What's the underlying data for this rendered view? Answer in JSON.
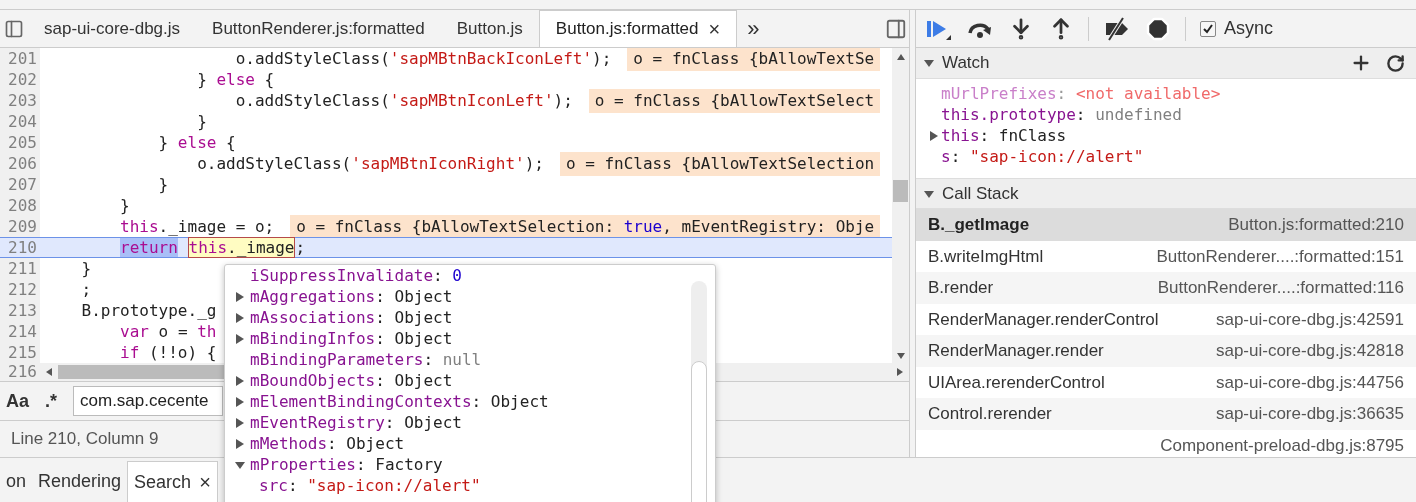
{
  "editor": {
    "tabs": [
      {
        "label": "sap-ui-core-dbg.js",
        "selected": false
      },
      {
        "label": "ButtonRenderer.js:formatted",
        "selected": false
      },
      {
        "label": "Button.js",
        "selected": false
      },
      {
        "label": "Button.js:formatted",
        "selected": true,
        "close": "×"
      }
    ],
    "more_tabs": "»",
    "lines": [
      {
        "number": "201",
        "current": false,
        "tokens": [
          {
            "text": "                    o.addStyleClass(",
            "kind": "plain"
          },
          {
            "text": "'sapMBtnBackIconLeft'",
            "kind": "string"
          },
          {
            "text": ");",
            "kind": "plain"
          }
        ],
        "annotation": [
          {
            "text": "o = fnClass {bAllowTextSe",
            "kind": "plain"
          }
        ]
      },
      {
        "number": "202",
        "current": false,
        "tokens": [
          {
            "text": "                } ",
            "kind": "plain"
          },
          {
            "text": "else",
            "kind": "keyword"
          },
          {
            "text": " {",
            "kind": "plain"
          }
        ]
      },
      {
        "number": "203",
        "current": false,
        "tokens": [
          {
            "text": "                    o.addStyleClass(",
            "kind": "plain"
          },
          {
            "text": "'sapMBtnIconLeft'",
            "kind": "string"
          },
          {
            "text": ");",
            "kind": "plain"
          }
        ],
        "annotation": [
          {
            "text": "o = fnClass {bAllowTextSelect",
            "kind": "plain"
          }
        ]
      },
      {
        "number": "204",
        "current": false,
        "tokens": [
          {
            "text": "                }",
            "kind": "plain"
          }
        ]
      },
      {
        "number": "205",
        "current": false,
        "tokens": [
          {
            "text": "            } ",
            "kind": "plain"
          },
          {
            "text": "else",
            "kind": "keyword"
          },
          {
            "text": " {",
            "kind": "plain"
          }
        ]
      },
      {
        "number": "206",
        "current": false,
        "tokens": [
          {
            "text": "                o.addStyleClass(",
            "kind": "plain"
          },
          {
            "text": "'sapMBtnIconRight'",
            "kind": "string"
          },
          {
            "text": ");",
            "kind": "plain"
          }
        ],
        "annotation": [
          {
            "text": "o = fnClass {bAllowTextSelection",
            "kind": "plain"
          }
        ]
      },
      {
        "number": "207",
        "current": false,
        "tokens": [
          {
            "text": "            }",
            "kind": "plain"
          }
        ]
      },
      {
        "number": "208",
        "current": false,
        "tokens": [
          {
            "text": "        }",
            "kind": "plain"
          }
        ]
      },
      {
        "number": "209",
        "current": false,
        "tokens": [
          {
            "text": "        this",
            "kind": "keyword"
          },
          {
            "text": "._image = o;",
            "kind": "plain"
          }
        ],
        "annotation": [
          {
            "text": "o = fnClass {bAllowTextSelection: ",
            "kind": "plain"
          },
          {
            "text": "true",
            "kind": "literal"
          },
          {
            "text": ", mEventRegistry: Obje",
            "kind": "plain"
          }
        ]
      },
      {
        "number": "210",
        "current": true,
        "tokens": [
          {
            "text": "        return",
            "kind": "keyword-selected"
          },
          {
            "text": " this",
            "kind": "keyword-evaluated"
          },
          {
            "text": "._image",
            "kind": "evaluated"
          },
          {
            "text": ";",
            "kind": "plain"
          }
        ]
      },
      {
        "number": "211",
        "current": false,
        "tokens": [
          {
            "text": "    }",
            "kind": "plain"
          }
        ]
      },
      {
        "number": "212",
        "current": false,
        "tokens": [
          {
            "text": "    ;",
            "kind": "plain"
          }
        ]
      },
      {
        "number": "213",
        "current": false,
        "tokens": [
          {
            "text": "    B.prototype._g",
            "kind": "plain"
          }
        ]
      },
      {
        "number": "214",
        "current": false,
        "tokens": [
          {
            "text": "        var",
            "kind": "keyword"
          },
          {
            "text": " o = ",
            "kind": "plain"
          },
          {
            "text": "th",
            "kind": "keyword"
          }
        ]
      },
      {
        "number": "215",
        "current": false,
        "tokens": [
          {
            "text": "        if",
            "kind": "keyword"
          },
          {
            "text": " (!!o) {",
            "kind": "plain"
          }
        ]
      }
    ],
    "last_line_number": "216",
    "search": {
      "case_toggle": "Aa",
      "regex_toggle": ".*",
      "value": "com.sap.cecente"
    },
    "status": "Line 210, Column 9",
    "popover": [
      {
        "key": "iSuppressInvalidate",
        "separator": ":",
        "value": "0",
        "kind": "number"
      },
      {
        "key": "mAggregations",
        "separator": ":",
        "value": "Object",
        "kind": "object",
        "expanded": false
      },
      {
        "key": "mAssociations",
        "separator": ":",
        "value": "Object",
        "kind": "object",
        "expanded": false
      },
      {
        "key": "mBindingInfos",
        "separator": ":",
        "value": "Object",
        "kind": "object",
        "expanded": false
      },
      {
        "key": "mBindingParameters",
        "separator": ":",
        "value": "null",
        "kind": "null"
      },
      {
        "key": "mBoundObjects",
        "separator": ":",
        "value": "Object",
        "kind": "object",
        "expanded": false
      },
      {
        "key": "mElementBindingContexts",
        "separator": ":",
        "value": "Object",
        "kind": "object",
        "expanded": false
      },
      {
        "key": "mEventRegistry",
        "separator": ":",
        "value": "Object",
        "kind": "object",
        "expanded": false
      },
      {
        "key": "mMethods",
        "separator": ":",
        "value": "Object",
        "kind": "object",
        "expanded": false
      },
      {
        "key": "mProperties",
        "separator": ":",
        "value": "Factory",
        "kind": "object",
        "expanded": true,
        "children": [
          {
            "key": "src",
            "separator": ":",
            "value": "\"sap-icon://alert\"",
            "kind": "string"
          }
        ]
      }
    ]
  },
  "debugger": {
    "async": {
      "label": "Async",
      "checked": true
    },
    "watch": {
      "title": "Watch",
      "expanded": true,
      "items": [
        {
          "name": "mUrlPrefixes",
          "separator": ":",
          "value": "<not available>",
          "kind": "unavailable"
        },
        {
          "name": "this.prototype",
          "separator": ":",
          "value": "undefined",
          "kind": "undefined"
        },
        {
          "name": "this",
          "separator": ":",
          "value": "fnClass",
          "kind": "object",
          "expanded": false
        },
        {
          "name": "s",
          "separator": ":",
          "value": "\"sap-icon://alert\"",
          "kind": "string"
        }
      ]
    },
    "call_stack": {
      "title": "Call Stack",
      "expanded": true,
      "frames": [
        {
          "name": "B._getImage",
          "location": "Button.js:formatted:210",
          "selected": true
        },
        {
          "name": "B.writeImgHtml",
          "location": "ButtonRenderer....:formatted:151",
          "selected": false
        },
        {
          "name": "B.render",
          "location": "ButtonRenderer....:formatted:116",
          "selected": false
        },
        {
          "name": "RenderManager.renderControl",
          "location": "sap-ui-core-dbg.js:42591",
          "selected": false
        },
        {
          "name": "RenderManager.render",
          "location": "sap-ui-core-dbg.js:42818",
          "selected": false
        },
        {
          "name": "UIArea.rerenderControl",
          "location": "sap-ui-core-dbg.js:44756",
          "selected": false
        },
        {
          "name": "Control.rerender",
          "location": "sap-ui-core-dbg.js:36635",
          "selected": false
        },
        {
          "location": "Component-preload-dbg.js:8795",
          "selected": false
        }
      ]
    }
  },
  "drawer_tabs": [
    {
      "label": "on",
      "selected": false
    },
    {
      "label": "Rendering",
      "selected": false
    },
    {
      "label": "Search",
      "selected": true,
      "close": "×"
    }
  ]
}
